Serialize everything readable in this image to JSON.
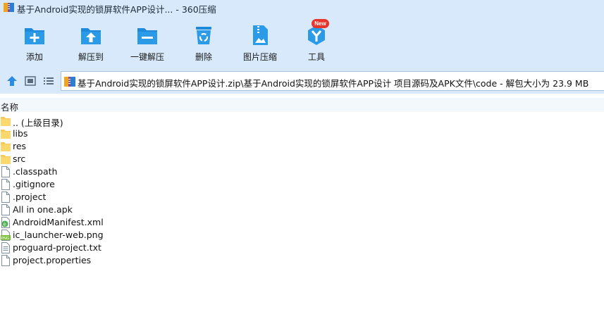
{
  "window": {
    "title": "基于Android实现的锁屏软件APP设计... - 360压缩",
    "accent": "#1e90e0",
    "chrome_bg": "#d7e9fa"
  },
  "toolbar": {
    "items": [
      {
        "label": "添加",
        "icon": "add-icon"
      },
      {
        "label": "解压到",
        "icon": "extract-to-icon"
      },
      {
        "label": "一键解压",
        "icon": "one-click-extract-icon"
      },
      {
        "label": "删除",
        "icon": "recycle-bin-icon"
      },
      {
        "label": "图片压缩",
        "icon": "image-compress-icon"
      },
      {
        "label": "工具",
        "icon": "tools-icon",
        "badge": "New"
      }
    ]
  },
  "address": {
    "path": "基于Android实现的锁屏软件APP设计.zip\\基于Android实现的锁屏软件APP设计 项目源码及APK文件\\code - 解包大小为 23.9 MB"
  },
  "list": {
    "column_name": "名称",
    "files": [
      {
        "name": ".. (上级目录)",
        "type": "folder"
      },
      {
        "name": "libs",
        "type": "folder"
      },
      {
        "name": "res",
        "type": "folder"
      },
      {
        "name": "src",
        "type": "folder"
      },
      {
        "name": ".classpath",
        "type": "file"
      },
      {
        "name": ".gitignore",
        "type": "file"
      },
      {
        "name": ".project",
        "type": "file"
      },
      {
        "name": "All in one.apk",
        "type": "file"
      },
      {
        "name": "AndroidManifest.xml",
        "type": "xml"
      },
      {
        "name": "ic_launcher-web.png",
        "type": "png"
      },
      {
        "name": "proguard-project.txt",
        "type": "text"
      },
      {
        "name": "project.properties",
        "type": "file"
      }
    ]
  }
}
